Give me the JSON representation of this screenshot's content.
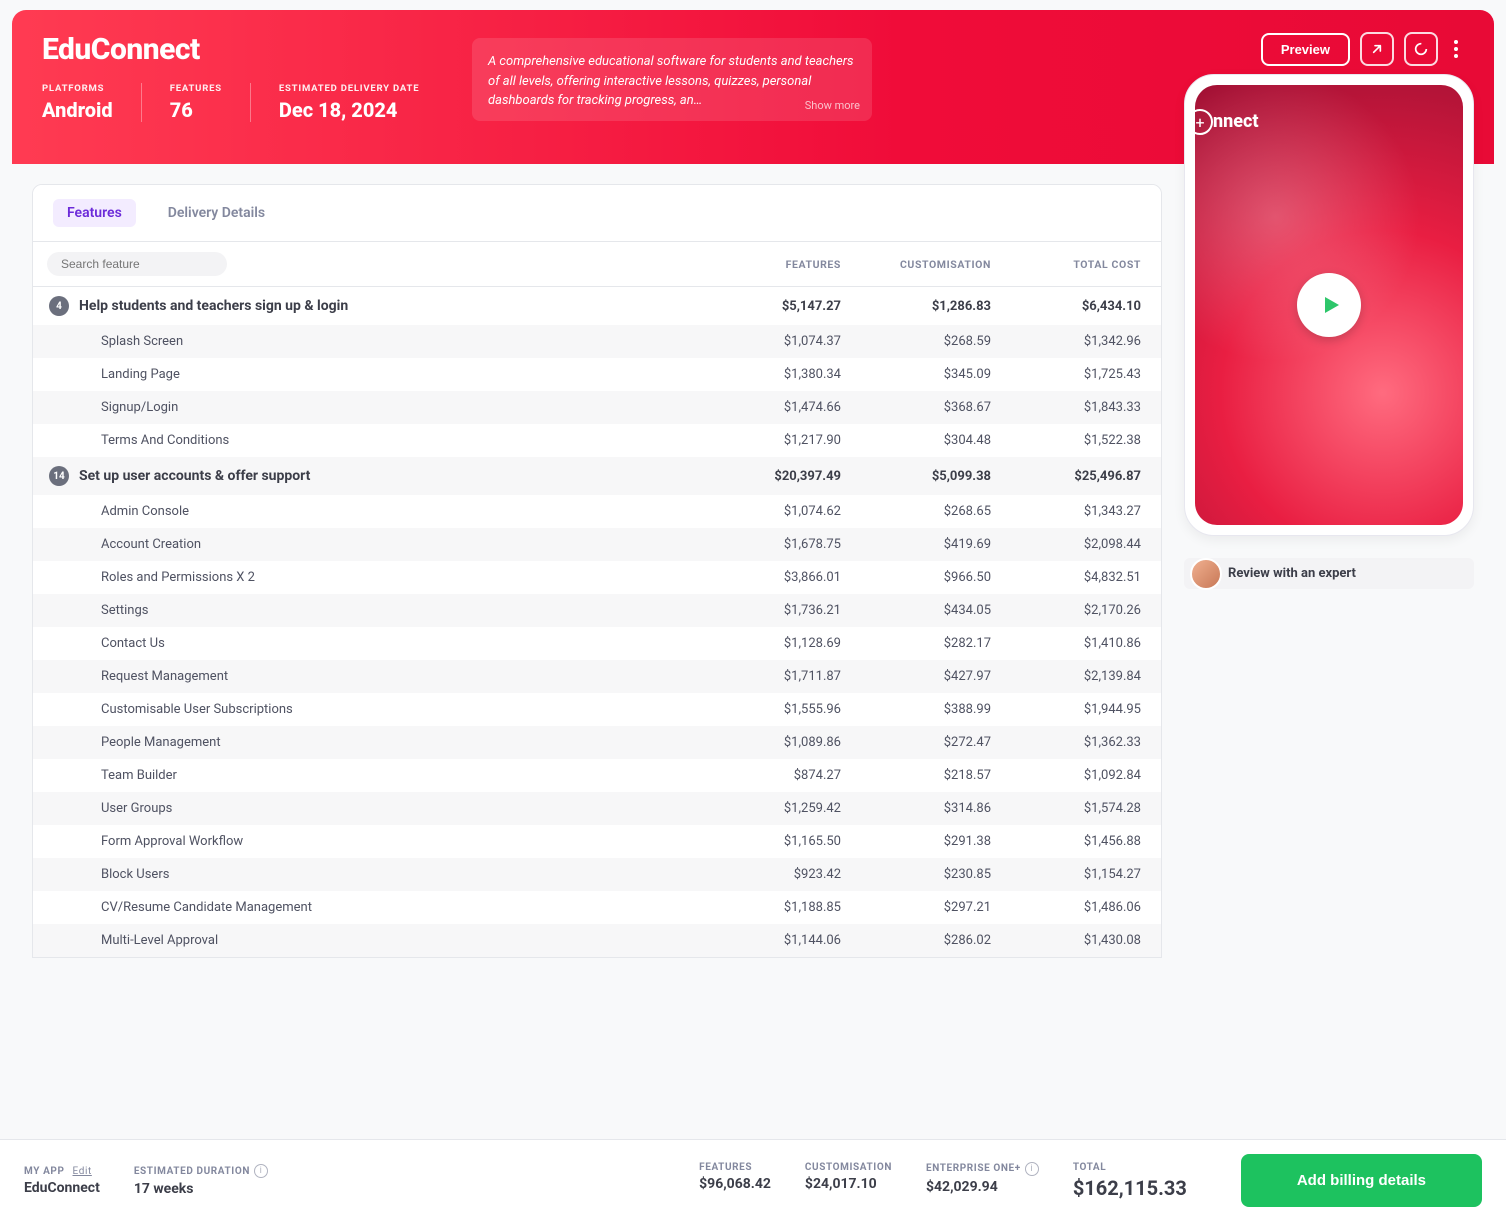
{
  "hero": {
    "title": "EduConnect",
    "stats": {
      "platforms": {
        "label": "PLATFORMS",
        "value": "Android"
      },
      "features": {
        "label": "FEATURES",
        "value": "76"
      },
      "delivery": {
        "label": "ESTIMATED DELIVERY DATE",
        "value": "Dec 18, 2024"
      }
    },
    "description": "A comprehensive educational software for students and teachers of all levels, offering interactive lessons, quizzes, personal dashboards for tracking progress, an…",
    "show_more": "Show more",
    "preview": "Preview"
  },
  "phone": {
    "title": "nnect"
  },
  "expert_cta": "Review with an expert",
  "tabs": {
    "features": "Features",
    "delivery": "Delivery Details"
  },
  "headers": {
    "features": "FEATURES",
    "customisation": "CUSTOMISATION",
    "total": "TOTAL COST"
  },
  "search_placeholder": "Search feature",
  "rows": [
    {
      "type": "group",
      "badge": "4",
      "name": "Help students and teachers sign up & login",
      "features": "$5,147.27",
      "cust": "$1,286.83",
      "total": "$6,434.10"
    },
    {
      "type": "sub",
      "name": "Splash Screen",
      "features": "$1,074.37",
      "cust": "$268.59",
      "total": "$1,342.96"
    },
    {
      "type": "sub",
      "name": "Landing Page",
      "features": "$1,380.34",
      "cust": "$345.09",
      "total": "$1,725.43"
    },
    {
      "type": "sub",
      "name": "Signup/Login",
      "features": "$1,474.66",
      "cust": "$368.67",
      "total": "$1,843.33"
    },
    {
      "type": "sub",
      "name": "Terms And Conditions",
      "features": "$1,217.90",
      "cust": "$304.48",
      "total": "$1,522.38"
    },
    {
      "type": "group",
      "badge": "14",
      "name": "Set up user accounts & offer support",
      "features": "$20,397.49",
      "cust": "$5,099.38",
      "total": "$25,496.87"
    },
    {
      "type": "sub",
      "name": "Admin Console",
      "features": "$1,074.62",
      "cust": "$268.65",
      "total": "$1,343.27"
    },
    {
      "type": "sub",
      "name": "Account Creation",
      "features": "$1,678.75",
      "cust": "$419.69",
      "total": "$2,098.44"
    },
    {
      "type": "sub",
      "name": "Roles and Permissions X 2",
      "features": "$3,866.01",
      "cust": "$966.50",
      "total": "$4,832.51"
    },
    {
      "type": "sub",
      "name": "Settings",
      "features": "$1,736.21",
      "cust": "$434.05",
      "total": "$2,170.26"
    },
    {
      "type": "sub",
      "name": "Contact Us",
      "features": "$1,128.69",
      "cust": "$282.17",
      "total": "$1,410.86"
    },
    {
      "type": "sub",
      "name": "Request Management",
      "features": "$1,711.87",
      "cust": "$427.97",
      "total": "$2,139.84"
    },
    {
      "type": "sub",
      "name": "Customisable User Subscriptions",
      "features": "$1,555.96",
      "cust": "$388.99",
      "total": "$1,944.95"
    },
    {
      "type": "sub",
      "name": "People Management",
      "features": "$1,089.86",
      "cust": "$272.47",
      "total": "$1,362.33"
    },
    {
      "type": "sub",
      "name": "Team Builder",
      "features": "$874.27",
      "cust": "$218.57",
      "total": "$1,092.84"
    },
    {
      "type": "sub",
      "name": "User Groups",
      "features": "$1,259.42",
      "cust": "$314.86",
      "total": "$1,574.28"
    },
    {
      "type": "sub",
      "name": "Form Approval Workflow",
      "features": "$1,165.50",
      "cust": "$291.38",
      "total": "$1,456.88"
    },
    {
      "type": "sub",
      "name": "Block Users",
      "features": "$923.42",
      "cust": "$230.85",
      "total": "$1,154.27"
    },
    {
      "type": "sub",
      "name": "CV/Resume Candidate Management",
      "features": "$1,188.85",
      "cust": "$297.21",
      "total": "$1,486.06"
    },
    {
      "type": "sub",
      "name": "Multi-Level Approval",
      "features": "$1,144.06",
      "cust": "$286.02",
      "total": "$1,430.08"
    }
  ],
  "footer": {
    "my_app": {
      "label": "MY APP",
      "value": "EduConnect",
      "edit": "Edit"
    },
    "duration": {
      "label": "ESTIMATED DURATION",
      "value": "17 weeks"
    },
    "features": {
      "label": "FEATURES",
      "value": "$96,068.42"
    },
    "customisation": {
      "label": "CUSTOMISATION",
      "value": "$24,017.10"
    },
    "enterprise": {
      "label": "ENTERPRISE ONE+",
      "value": "$42,029.94"
    },
    "total": {
      "label": "TOTAL",
      "value": "$162,115.33"
    },
    "cta": "Add billing details"
  }
}
